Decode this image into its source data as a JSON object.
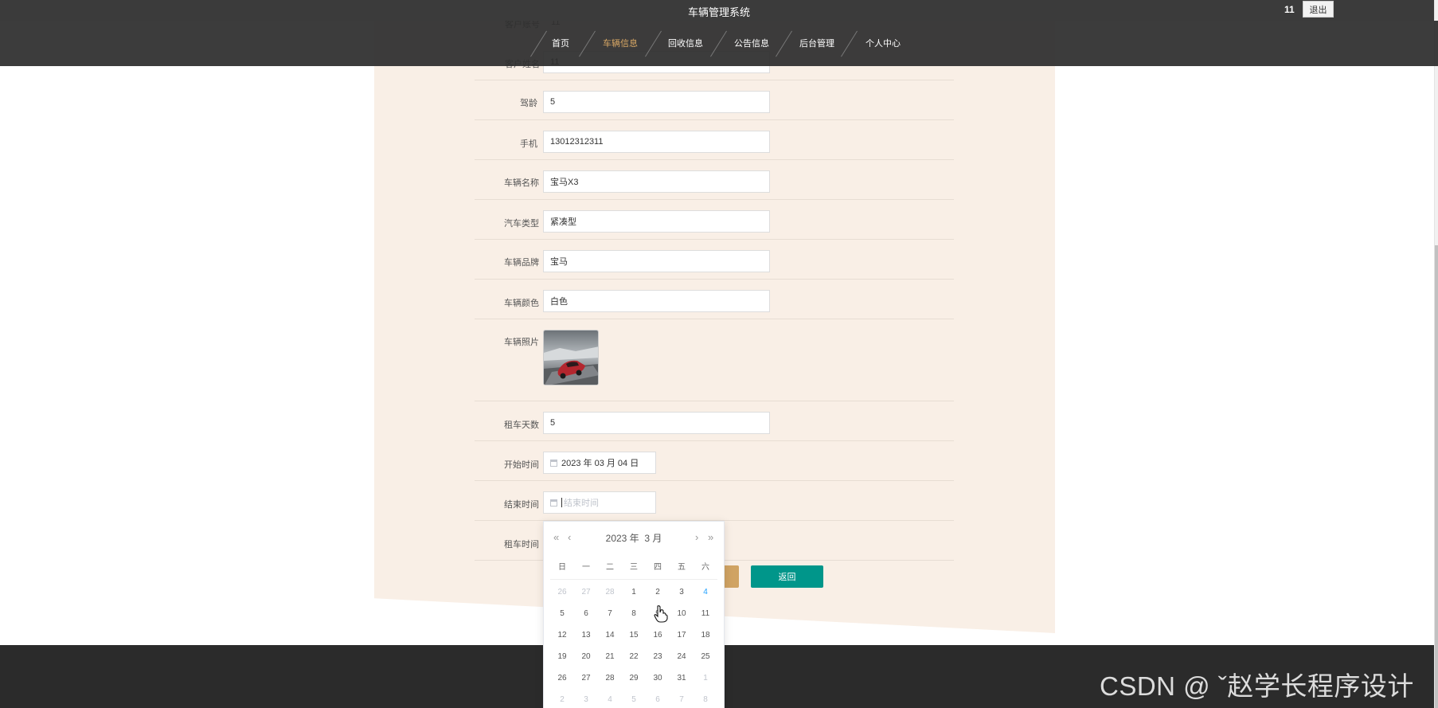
{
  "header": {
    "title": "车辆管理系统",
    "username": "11",
    "logout_label": "退出"
  },
  "nav": [
    {
      "label": "首页",
      "active": false
    },
    {
      "label": "车辆信息",
      "active": true
    },
    {
      "label": "回收信息",
      "active": false
    },
    {
      "label": "公告信息",
      "active": false
    },
    {
      "label": "后台管理",
      "active": false
    },
    {
      "label": "个人中心",
      "active": false
    }
  ],
  "peek_rows": [
    {
      "value": "11"
    },
    {
      "label": "客户姓名",
      "value": "11"
    }
  ],
  "form": {
    "driving_age": {
      "label": "驾龄",
      "value": "5"
    },
    "phone": {
      "label": "手机",
      "value": "13012312311"
    },
    "vehicle_name": {
      "label": "车辆名称",
      "value": "宝马X3"
    },
    "car_type": {
      "label": "汽车类型",
      "value": "紧凑型"
    },
    "brand": {
      "label": "车辆品牌",
      "value": "宝马"
    },
    "color": {
      "label": "车辆颜色",
      "value": "白色"
    },
    "photo": {
      "label": "车辆照片"
    },
    "rental_days": {
      "label": "租车天数",
      "value": "5"
    },
    "start_time": {
      "label": "开始时间",
      "value": "2023 年 03 月 04 日"
    },
    "end_time": {
      "label": "结束时间",
      "placeholder": "结束时间"
    },
    "rental_time": {
      "label": "租车时间"
    }
  },
  "buttons": {
    "back_label": "返回"
  },
  "calendar": {
    "title_year": "2023 年",
    "title_month": "3 月",
    "weekdays": [
      "日",
      "一",
      "二",
      "三",
      "四",
      "五",
      "六"
    ],
    "weeks": [
      [
        {
          "d": "26",
          "o": true
        },
        {
          "d": "27",
          "o": true
        },
        {
          "d": "28",
          "o": true
        },
        {
          "d": "1"
        },
        {
          "d": "2"
        },
        {
          "d": "3"
        },
        {
          "d": "4",
          "t": true
        }
      ],
      [
        {
          "d": "5"
        },
        {
          "d": "6"
        },
        {
          "d": "7"
        },
        {
          "d": "8"
        },
        {
          "d": "9"
        },
        {
          "d": "10"
        },
        {
          "d": "11"
        }
      ],
      [
        {
          "d": "12"
        },
        {
          "d": "13"
        },
        {
          "d": "14"
        },
        {
          "d": "15"
        },
        {
          "d": "16"
        },
        {
          "d": "17"
        },
        {
          "d": "18"
        }
      ],
      [
        {
          "d": "19"
        },
        {
          "d": "20"
        },
        {
          "d": "21"
        },
        {
          "d": "22"
        },
        {
          "d": "23"
        },
        {
          "d": "24"
        },
        {
          "d": "25"
        }
      ],
      [
        {
          "d": "26"
        },
        {
          "d": "27"
        },
        {
          "d": "28"
        },
        {
          "d": "29"
        },
        {
          "d": "30"
        },
        {
          "d": "31"
        },
        {
          "d": "1",
          "o": true
        }
      ],
      [
        {
          "d": "2",
          "o": true
        },
        {
          "d": "3",
          "o": true
        },
        {
          "d": "4",
          "o": true
        },
        {
          "d": "5",
          "o": true
        },
        {
          "d": "6",
          "o": true
        },
        {
          "d": "7",
          "o": true
        },
        {
          "d": "8",
          "o": true
        }
      ]
    ]
  },
  "watermark": "CSDN @ ˇ赵学长程序设计",
  "colors": {
    "accent": "#d9a865",
    "primary_button": "#00968a",
    "submit_button": "#d0a363",
    "content_bg": "#f9efe6",
    "topbar": "#3b3b3b",
    "today": "#1e9fff"
  }
}
